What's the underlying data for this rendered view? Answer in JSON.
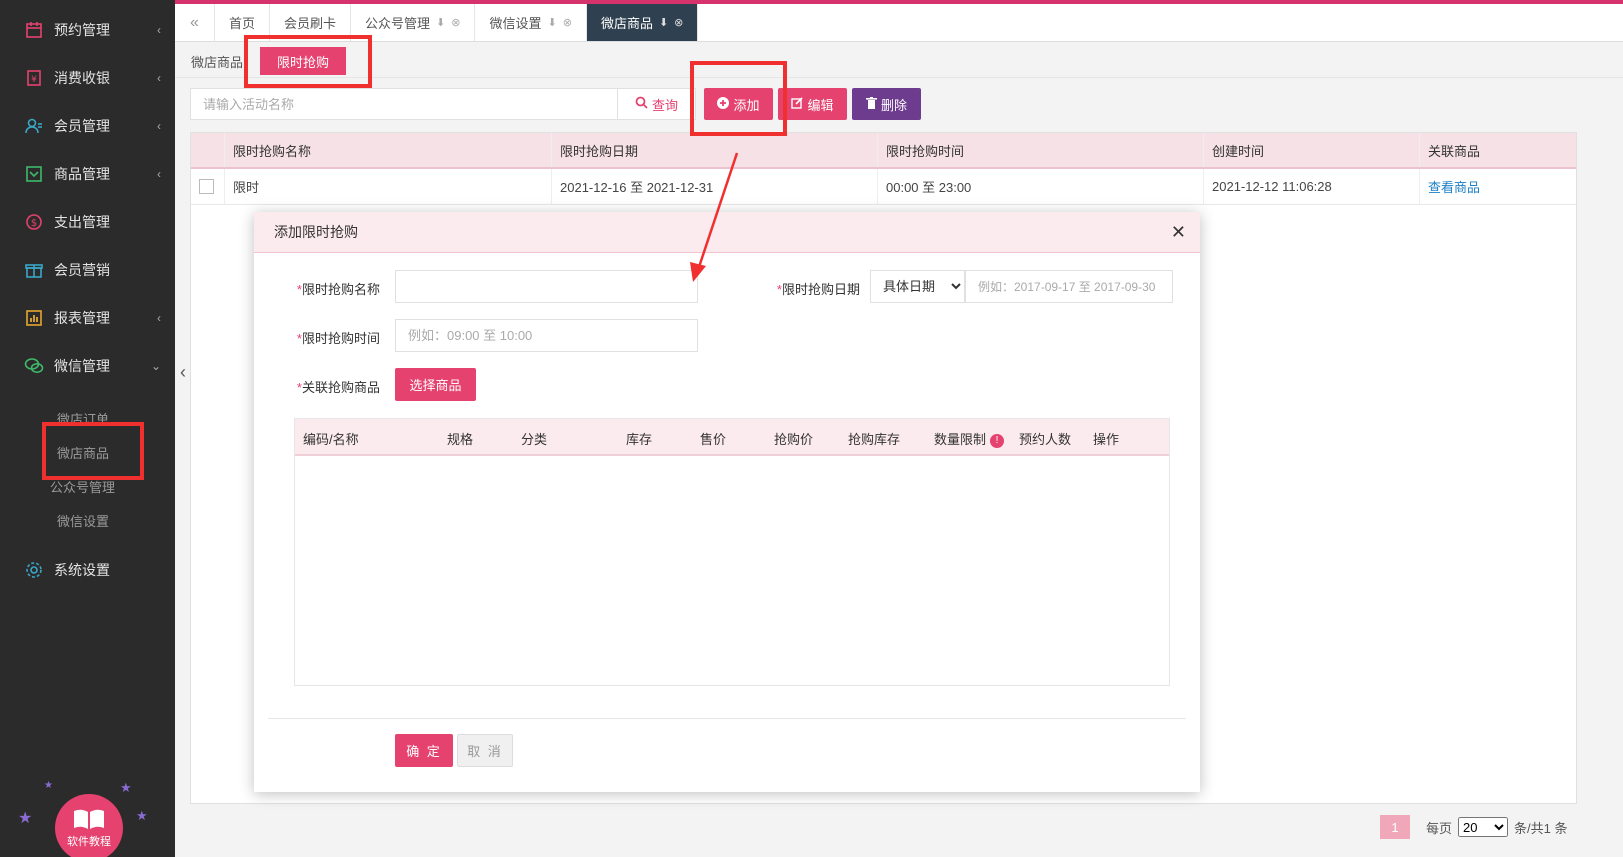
{
  "sidebar": {
    "items": [
      {
        "label": "预约管理",
        "icon": "calendar-icon"
      },
      {
        "label": "消费收银",
        "icon": "cashier-icon"
      },
      {
        "label": "会员管理",
        "icon": "members-icon"
      },
      {
        "label": "商品管理",
        "icon": "goods-icon"
      },
      {
        "label": "支出管理",
        "icon": "expense-icon"
      },
      {
        "label": "会员营销",
        "icon": "gift-icon"
      },
      {
        "label": "报表管理",
        "icon": "chart-icon"
      },
      {
        "label": "微信管理",
        "icon": "wechat-icon"
      },
      {
        "label": "系统设置",
        "icon": "gear-icon"
      }
    ],
    "sub_items": [
      "微店订单",
      "微店商品",
      "公众号管理",
      "微信设置"
    ],
    "tutorial_label": "软件教程"
  },
  "tabs": [
    "首页",
    "会员刷卡",
    "公众号管理",
    "微信设置",
    "微店商品"
  ],
  "subtabs": {
    "label": "微店商品",
    "active": "限时抢购"
  },
  "toolbar": {
    "search_placeholder": "请输入活动名称",
    "query_label": "查询",
    "add_label": "添加",
    "edit_label": "编辑",
    "delete_label": "删除"
  },
  "table": {
    "headers": [
      "限时抢购名称",
      "限时抢购日期",
      "限时抢购时间",
      "创建时间",
      "关联商品"
    ],
    "rows": [
      {
        "name": "限时",
        "date": "2021-12-16 至 2021-12-31",
        "time": "00:00 至 23:00",
        "created": "2021-12-12 11:06:28",
        "goods_link": "查看商品"
      }
    ]
  },
  "pager": {
    "current": "1",
    "per_page_prefix": "每页",
    "per_page": "20",
    "summary": "条/共1 条"
  },
  "modal": {
    "title": "添加限时抢购",
    "name_label": "限时抢购名称",
    "date_label": "限时抢购日期",
    "date_mode": "具体日期",
    "date_placeholder": "例如：2017-09-17 至 2017-09-30",
    "time_label": "限时抢购时间",
    "time_placeholder": "例如：09:00 至 10:00",
    "goods_label": "关联抢购商品",
    "pick_label": "选择商品",
    "sub_headers": [
      "编码/名称",
      "规格",
      "分类",
      "库存",
      "售价",
      "抢购价",
      "抢购库存",
      "数量限制",
      "预约人数",
      "操作"
    ],
    "required_mark": "*",
    "ok_label": "确 定",
    "cancel_label": "取 消"
  },
  "colors": {
    "accent": "#e5426f",
    "purple": "#6e3c8f",
    "highlight": "#f0302f",
    "sidebar_bg": "#2b2b2b"
  }
}
